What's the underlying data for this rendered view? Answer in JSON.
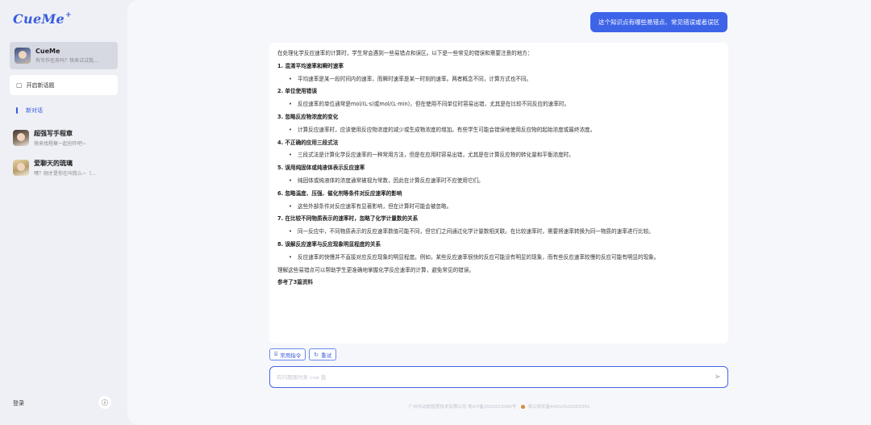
{
  "app": {
    "logo": "CueMe"
  },
  "sidebar": {
    "agent": {
      "name": "CueMe",
      "subtitle": "有写作任务吗？快来试试我..."
    },
    "new_topic": "开启新话题",
    "section_label": "新对话",
    "conversations": [
      {
        "title": "超强写手程章",
        "subtitle": "快来找程章一起创作吧~"
      },
      {
        "title": "爱聊天的琉璃",
        "subtitle": "嘿？刚才是你在叫我么~（..."
      }
    ],
    "login": "登录",
    "info_icon": "info-icon"
  },
  "chat": {
    "user_message": "这个知识点有哪些易错点、常见错误或者误区",
    "answer": {
      "intro": "在处理化学反应速率的计算时，学生常会遇到一些易错点和误区。以下是一些常见的错误和需要注意的地方：",
      "items": [
        {
          "heading": "1. 混淆平均速率和瞬时速率",
          "bullet": "平均速率是某一段时间内的速率，而瞬时速率是某一时刻的速率。两者概念不同，计算方式也不同。"
        },
        {
          "heading": "2. 单位使用错误",
          "bullet": "反应速率的单位通常是mol/(L·s)或mol/(L·min)，但在使用不同单位时容易出错，尤其是在比较不同反应的速率时。"
        },
        {
          "heading": "3. 忽略反应物浓度的变化",
          "bullet": "计算反应速率时，应该使用反应物浓度的减少或生成物浓度的增加。有些学生可能会错误地使用反应物的起始浓度或最终浓度。"
        },
        {
          "heading": "4. 不正确的应用三段式法",
          "bullet": "三段式法是计算化学反应速率的一种常用方法，但是在应用时容易出错，尤其是在计算反应物的转化量和平衡浓度时。"
        },
        {
          "heading": "5. 误用纯固体或纯液体表示反应速率",
          "bullet": "纯固体或纯液体的浓度通常被视为常数，因此在计算反应速率时不应使用它们。"
        },
        {
          "heading": "6. 忽略温度、压强、催化剂等条件对反应速率的影响",
          "bullet": "这些外部条件对反应速率有显著影响，但在计算时可能会被忽略。"
        },
        {
          "heading": "7. 在比较不同物质表示的速率时，忽略了化学计量数的关系",
          "bullet": "同一反应中，不同物质表示的反应速率数值可能不同，但它们之间通过化学计量数相关联。在比较速率时，需要将速率转换为同一物质的速率进行比较。"
        },
        {
          "heading": "8. 误解反应速率与反应现象明显程度的关系",
          "bullet": "反应速率的快慢并不直接对应反应现象的明显程度。例如，某些反应速率很快的反应可能没有明显的现象，而有些反应速率较慢的反应可能有明显的现象。"
        }
      ],
      "conclusion": "理解这些易错点可以帮助学生更准确地掌握化学反应速率的计算，避免常见的错误。",
      "cut_off": "参考了3篇资料"
    },
    "actions": [
      {
        "icon": "command-icon",
        "glyph": "⌸",
        "label": "常用指令"
      },
      {
        "icon": "refresh-icon",
        "glyph": "↻",
        "label": "重试"
      }
    ],
    "input": {
      "placeholder": "有问题随时来 cue 我",
      "value": ""
    },
    "send_icon": "send-icon"
  },
  "footer": {
    "icp": "广州市动旅智慧技术有限公司 粤ICP备2022013084号",
    "police": "粤公网安备44010502003355"
  },
  "colors": {
    "accent": "#3d64e8",
    "sidebar_bg": "#eef0f6",
    "main_bg": "#f6f7fa"
  }
}
